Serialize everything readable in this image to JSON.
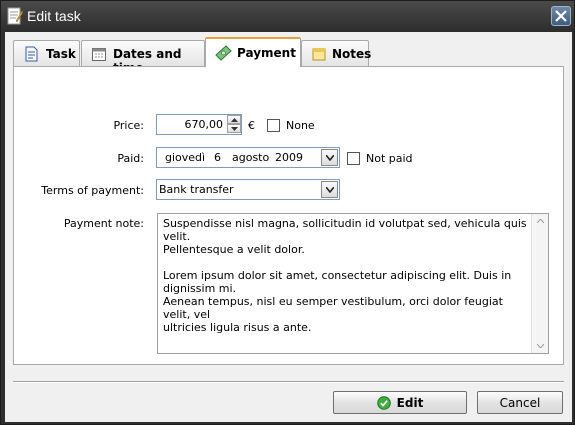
{
  "window": {
    "title": "Edit task"
  },
  "tabs": [
    {
      "label": "Task",
      "icon": "document-icon"
    },
    {
      "label": "Dates and time",
      "icon": "calendar-icon"
    },
    {
      "label": "Payment",
      "icon": "banknote-icon",
      "active": true
    },
    {
      "label": "Notes",
      "icon": "note-icon"
    }
  ],
  "form": {
    "price_label": "Price:",
    "price_value": "670,00",
    "currency": "€",
    "none_label": "None",
    "none_checked": false,
    "paid_label": "Paid:",
    "paid_date": {
      "weekday": "giovedì",
      "day": "6",
      "month": "agosto",
      "year": "2009"
    },
    "not_paid_label": "Not paid",
    "not_paid_checked": false,
    "terms_label": "Terms of payment:",
    "terms_value": "Bank transfer",
    "note_label": "Payment note:",
    "note_text": "Suspendisse nisl magna, sollicitudin id volutpat sed, vehicula quis velit.\nPellentesque a velit dolor.\n\nLorem ipsum dolor sit amet, consectetur adipiscing elit. Duis in dignissim mi.\nAenean tempus, nisl eu semper vestibulum, orci dolor feugiat velit, vel\nultricies ligula risus a ante."
  },
  "buttons": {
    "edit_label": "Edit",
    "cancel_label": "Cancel"
  },
  "colors": {
    "active_tab_accent": "#e6a33a",
    "titlebar": "#2e2e2e",
    "edit_icon": "#3cae3c"
  }
}
